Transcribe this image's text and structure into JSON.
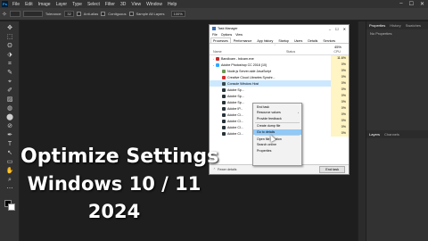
{
  "photoshop": {
    "logo": "Ps",
    "menu": [
      "File",
      "Edit",
      "Image",
      "Layer",
      "Type",
      "Select",
      "Filter",
      "3D",
      "View",
      "Window",
      "Help"
    ],
    "window_controls": [
      "–",
      "☐",
      "✕"
    ],
    "options": {
      "tolerance_label": "Tolerance:",
      "tolerance_value": "32",
      "antialias_label": "Anti-alias",
      "contiguous_label": "Contiguous",
      "sample_label": "Sample All Layers",
      "zoom_value": "100%"
    },
    "tools": [
      "✥",
      "⬚",
      "ʘ",
      "⬗",
      "⌗",
      "✎",
      "⌖",
      "✐",
      "▨",
      "◍",
      "⬤",
      "⊘",
      "✒",
      "T",
      "↖",
      "▭",
      "✋",
      "⌕",
      "⋯"
    ],
    "right_panels": {
      "tabs_top": [
        "Properties",
        "History",
        "Swatches"
      ],
      "no_properties": "No Properties",
      "tabs_bottom": [
        "Layers",
        "Channels"
      ]
    }
  },
  "task_manager": {
    "title": "Task Manager",
    "controls": [
      "–",
      "☐",
      "✕"
    ],
    "menu": [
      "File",
      "Options",
      "View"
    ],
    "tabs": [
      "Processes",
      "Performance",
      "App history",
      "Startup",
      "Users",
      "Details",
      "Services"
    ],
    "active_tab": "Processes",
    "header": {
      "cpu_percent": "45%",
      "cpu_label": "CPU",
      "name_label": "Name",
      "status_label": "Status"
    },
    "rows": [
      {
        "name": "Bandicam - bdcam.exe",
        "cpu": "11.6%",
        "color": "#c62828",
        "expand": "›"
      },
      {
        "name": "Adobe Photoshop CC 2018 (10)",
        "cpu": "0%",
        "color": "#31a8ff",
        "expand": "⌄"
      },
      {
        "name": "Node.js Server-side JavaScript",
        "cpu": "0%",
        "color": "#6a9955",
        "expand": ""
      },
      {
        "name": "Creative Cloud Libraries Synchr...",
        "cpu": "0%",
        "color": "#d32f2f",
        "expand": ""
      },
      {
        "name": "Console Window Host",
        "cpu": "0%",
        "color": "#37474f",
        "expand": ""
      },
      {
        "name": "Adobe Sp...",
        "cpu": "0%",
        "color": "#263238",
        "expand": ""
      },
      {
        "name": "Adobe Sp...",
        "cpu": "0%",
        "color": "#263238",
        "expand": ""
      },
      {
        "name": "Adobe Sp...",
        "cpu": "0%",
        "color": "#263238",
        "expand": ""
      },
      {
        "name": "Adobe IP...",
        "cpu": "0%",
        "color": "#263238",
        "expand": ""
      },
      {
        "name": "Adobe Cl...",
        "cpu": "0%",
        "color": "#263238",
        "expand": ""
      },
      {
        "name": "Adobe Cl...",
        "cpu": "0%",
        "color": "#263238",
        "expand": ""
      },
      {
        "name": "Adobe Cl...",
        "cpu": "0%",
        "color": "#263238",
        "expand": ""
      },
      {
        "name": "Adobe Cl...",
        "cpu": "0%",
        "color": "#263238",
        "expand": ""
      }
    ],
    "selected_row": 4,
    "footer": {
      "fewer_details": "Fewer details",
      "end_task": "End task"
    }
  },
  "context_menu": {
    "items": [
      {
        "label": "End task",
        "sub": false
      },
      {
        "label": "Resource values",
        "sub": true
      },
      {
        "label": "Provide feedback",
        "sub": false
      },
      {
        "label": "Create dump file",
        "sub": false
      },
      {
        "label": "Go to details",
        "sub": false
      },
      {
        "label": "Open file location",
        "sub": false
      },
      {
        "label": "Search online",
        "sub": false
      },
      {
        "label": "Properties",
        "sub": false
      }
    ],
    "highlighted": 4
  },
  "overlay": {
    "line1": "Optimize Settings",
    "line2": "Windows 10 / 11",
    "line3": "2024"
  }
}
